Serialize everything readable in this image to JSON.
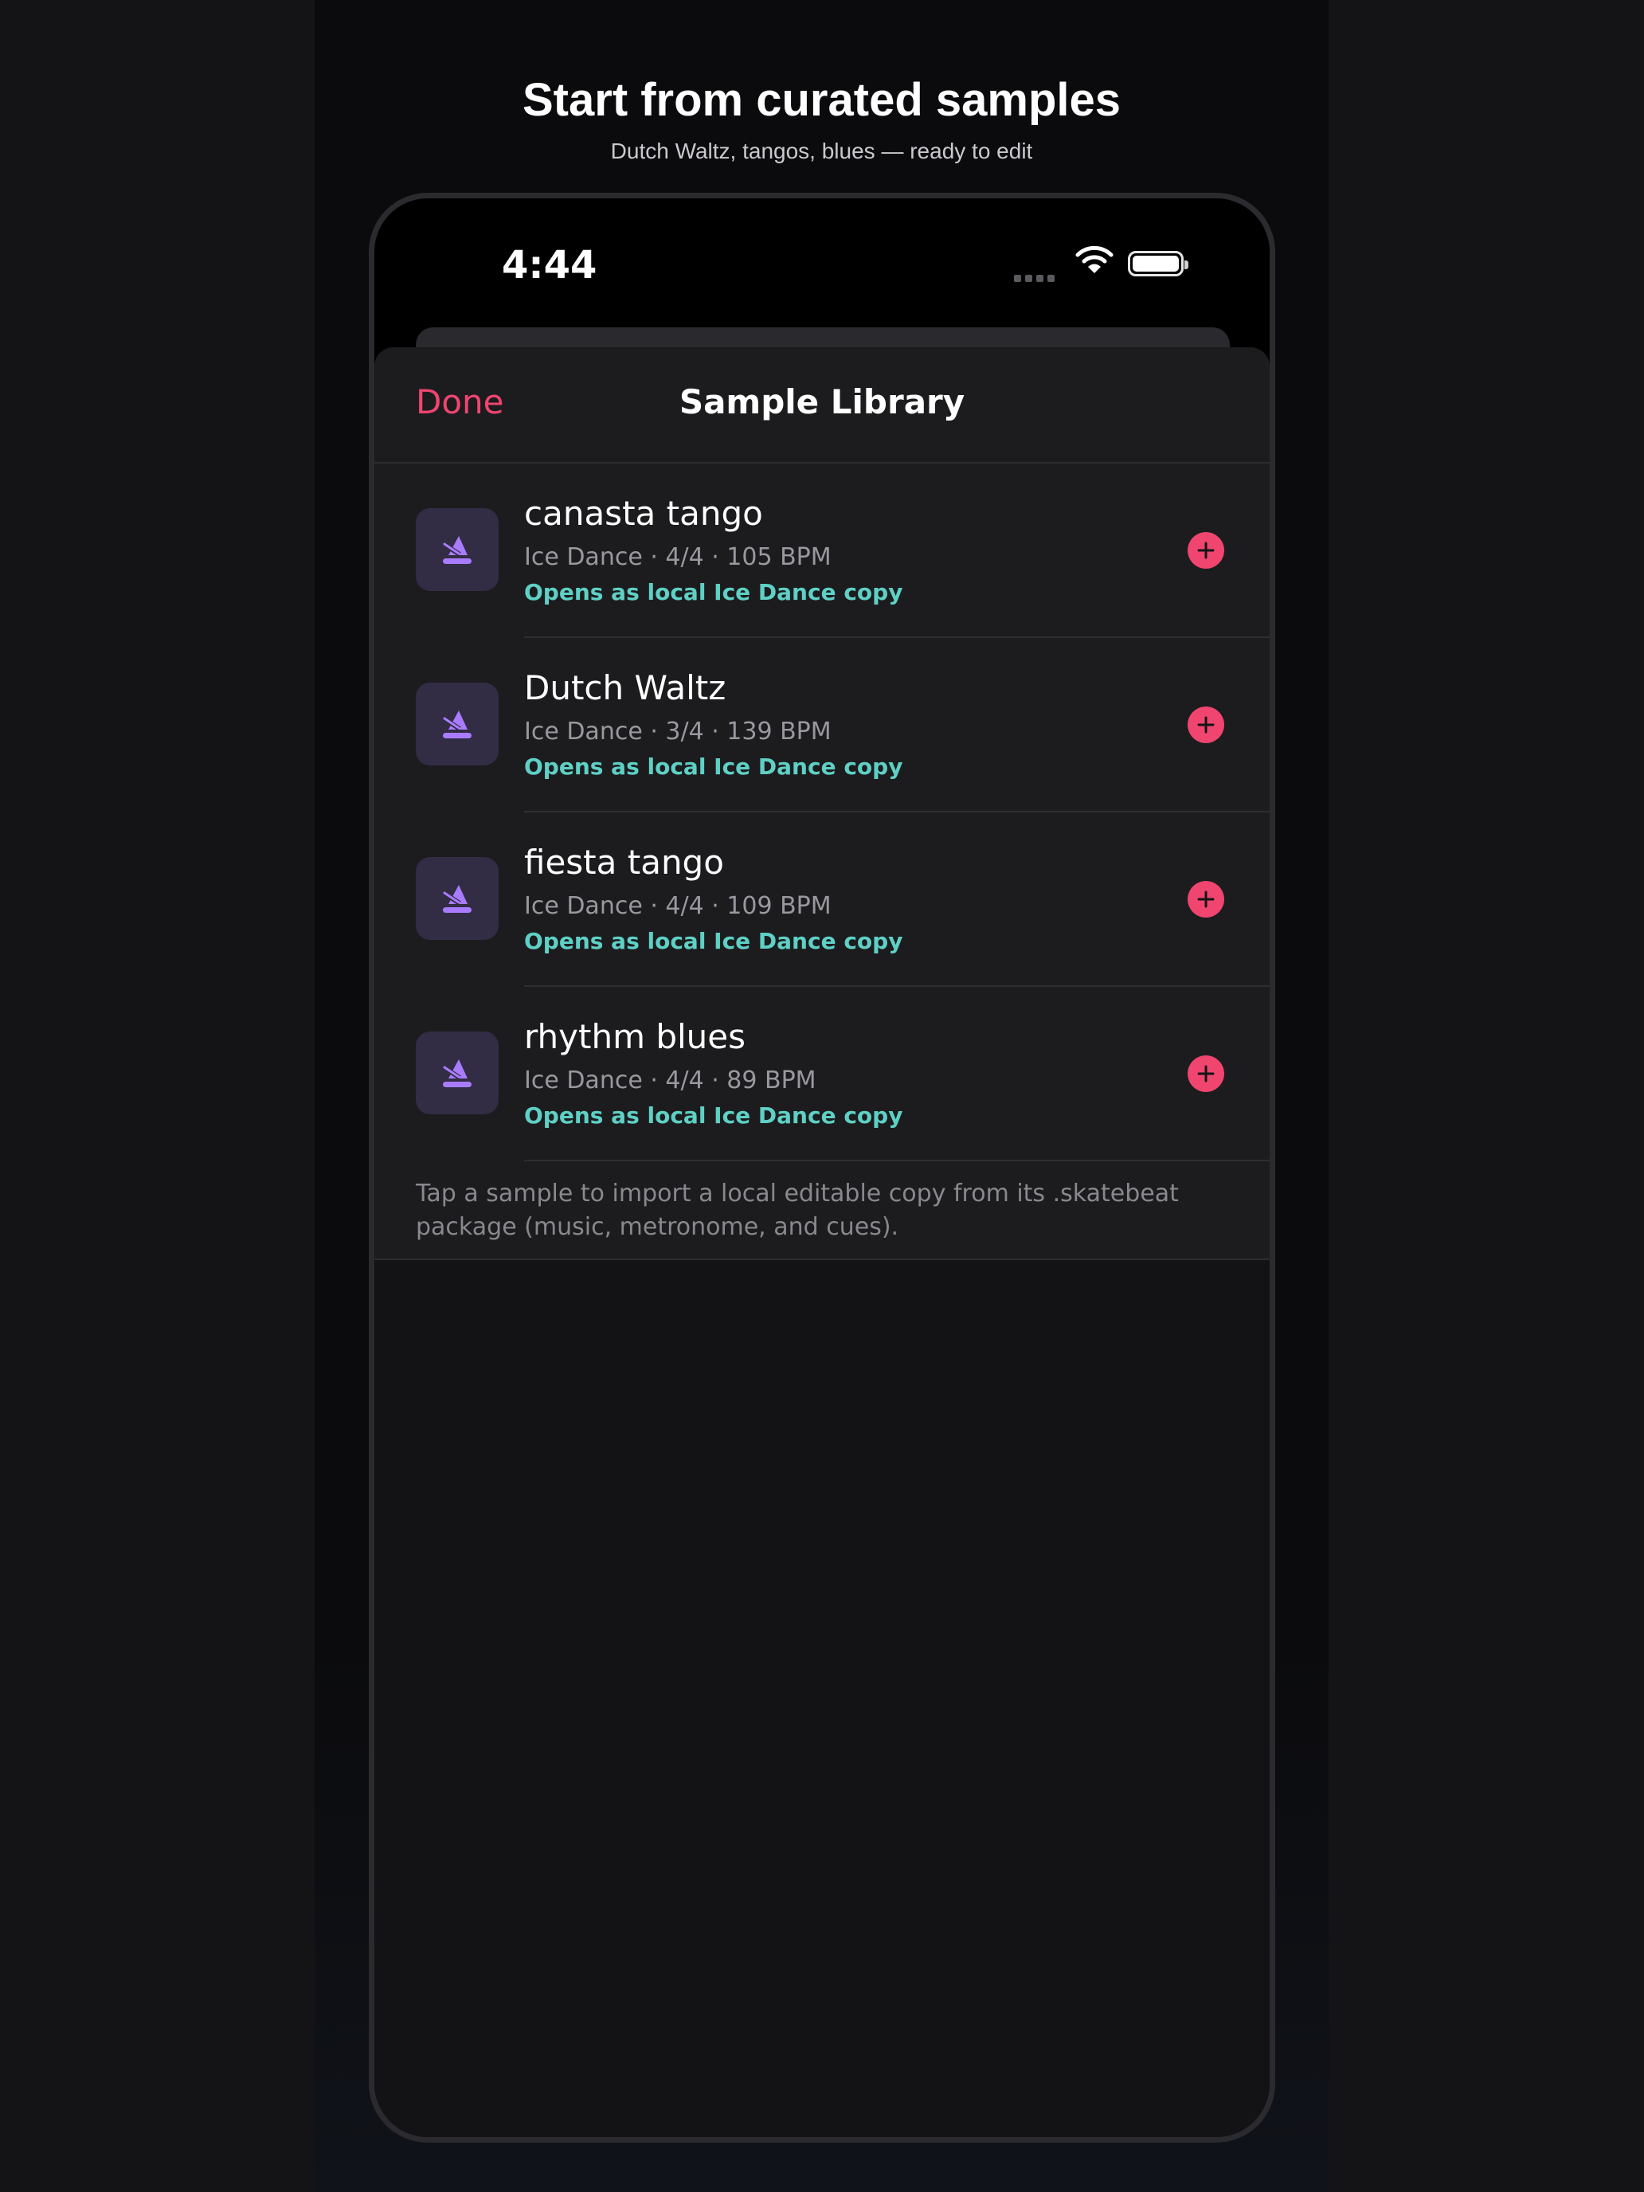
{
  "promo": {
    "title": "Start from curated samples",
    "subtitle": "Dutch Waltz, tangos, blues — ready to edit"
  },
  "status_bar": {
    "time": "4:44",
    "icons": [
      "cellular-signal-icon",
      "wifi-icon",
      "battery-icon"
    ]
  },
  "navbar": {
    "done_label": "Done",
    "title": "Sample Library"
  },
  "samples": [
    {
      "title": "canasta tango",
      "meta": "Ice Dance · 4/4 · 105 BPM",
      "note": "Opens as local Ice Dance copy",
      "icon": "metronome-icon",
      "action_icon": "plus-circle-icon"
    },
    {
      "title": "Dutch Waltz",
      "meta": "Ice Dance · 3/4 · 139 BPM",
      "note": "Opens as local Ice Dance copy",
      "icon": "metronome-icon",
      "action_icon": "plus-circle-icon"
    },
    {
      "title": "fiesta tango",
      "meta": "Ice Dance · 4/4 · 109 BPM",
      "note": "Opens as local Ice Dance copy",
      "icon": "metronome-icon",
      "action_icon": "plus-circle-icon"
    },
    {
      "title": "rhythm blues",
      "meta": "Ice Dance · 4/4 · 89 BPM",
      "note": "Opens as local Ice Dance copy",
      "icon": "metronome-icon",
      "action_icon": "plus-circle-icon"
    }
  ],
  "footer_text": "Tap a sample to import a local editable copy from its .skatebeat package (music, metronome, and cues).",
  "colors": {
    "accent": "#f0456f",
    "note": "#5fd0c5",
    "icon_tile": "#322c44",
    "icon_glyph": "#a97cff",
    "row_background": "#1c1c1e",
    "sheet_background": "#131315"
  }
}
